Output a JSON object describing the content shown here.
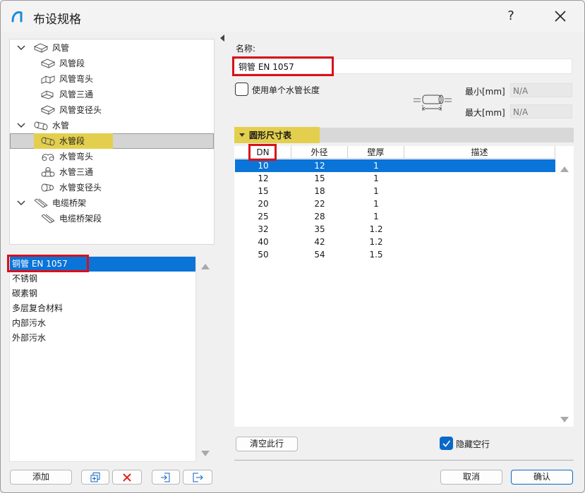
{
  "window": {
    "title": "布设规格",
    "help_label": "?"
  },
  "tree": {
    "items": [
      {
        "label": "风管",
        "level": 0,
        "expanded": true,
        "icon": "duct-icon"
      },
      {
        "label": "风管段",
        "level": 1,
        "icon": "duct-segment-icon"
      },
      {
        "label": "风管弯头",
        "level": 1,
        "icon": "duct-elbow-icon"
      },
      {
        "label": "风管三通",
        "level": 1,
        "icon": "duct-tee-icon"
      },
      {
        "label": "风管变径头",
        "level": 1,
        "icon": "duct-reducer-icon"
      },
      {
        "label": "水管",
        "level": 0,
        "expanded": true,
        "icon": "pipe-icon"
      },
      {
        "label": "水管段",
        "level": 1,
        "icon": "pipe-segment-icon",
        "selected": true
      },
      {
        "label": "水管弯头",
        "level": 1,
        "icon": "pipe-elbow-icon"
      },
      {
        "label": "水管三通",
        "level": 1,
        "icon": "pipe-tee-icon"
      },
      {
        "label": "水管变径头",
        "level": 1,
        "icon": "pipe-reducer-icon"
      },
      {
        "label": "电缆桥架",
        "level": 0,
        "expanded": true,
        "icon": "cable-tray-icon"
      },
      {
        "label": "电缆桥架段",
        "level": 1,
        "icon": "cable-tray-segment-icon"
      }
    ]
  },
  "materials": {
    "items": [
      "铜管 EN 1057",
      "不锈钢",
      "碳素钢",
      "多层复合材料",
      "内部污水",
      "外部污水"
    ],
    "selected_index": 0
  },
  "left_buttons": {
    "add_label": "添加"
  },
  "form": {
    "name_label": "名称:",
    "name_value": "铜管 EN 1057",
    "single_length_label": "使用单个水管长度",
    "single_length_checked": false,
    "min_label": "最小[mm]",
    "min_value": "N/A",
    "max_label": "最大[mm]",
    "max_value": "N/A"
  },
  "table": {
    "section_title": "圆形尺寸表",
    "columns": [
      "DN",
      "外径",
      "壁厚",
      "描述"
    ],
    "rows": [
      [
        "10",
        "12",
        "1",
        ""
      ],
      [
        "12",
        "15",
        "1",
        ""
      ],
      [
        "15",
        "18",
        "1",
        ""
      ],
      [
        "20",
        "22",
        "1",
        ""
      ],
      [
        "25",
        "28",
        "1",
        ""
      ],
      [
        "32",
        "35",
        "1.2",
        ""
      ],
      [
        "40",
        "42",
        "1.2",
        ""
      ],
      [
        "50",
        "54",
        "1.5",
        ""
      ]
    ],
    "selected_row": 0
  },
  "bottom": {
    "clear_row_label": "清空此行",
    "hide_empty_label": "隐藏空行",
    "hide_empty_checked": true,
    "cancel_label": "取消",
    "ok_label": "确认"
  },
  "colors": {
    "accent": "#0a74d8",
    "highlight_yellow": "#e3cf4d",
    "annotation_red": "#d9101a"
  }
}
